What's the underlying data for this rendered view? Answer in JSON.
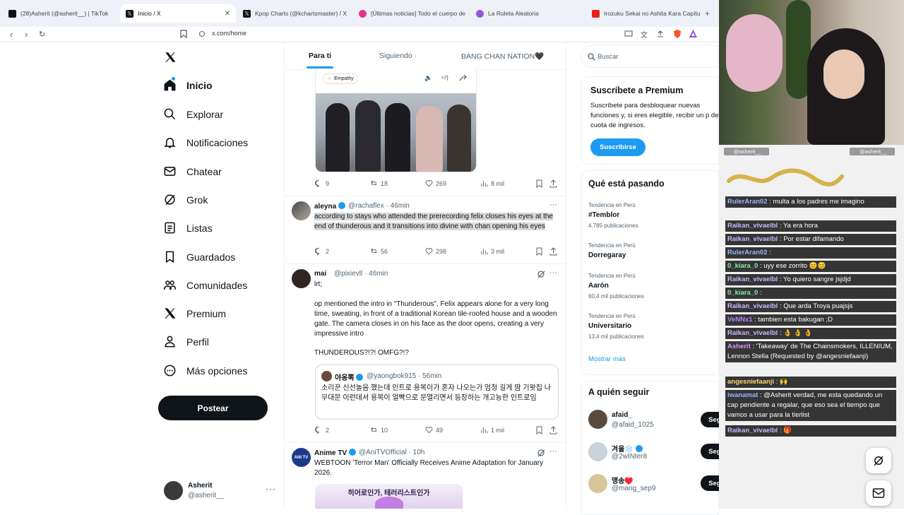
{
  "browser": {
    "tabs": [
      {
        "label": "(28)Asherit (@asherit__) | TikTok",
        "icon": "tiktok-icon",
        "color": "#111"
      },
      {
        "label": "Inicio / X",
        "icon": "x-logo-icon",
        "color": "#111",
        "active": true
      },
      {
        "label": "Kpop Charts (@kchartsmaster) / X",
        "icon": "x-logo-icon",
        "color": "#111"
      },
      {
        "label": "[Últimas noticias] Todo el cuerpo de",
        "icon": "news-icon",
        "color": "#e0348c"
      },
      {
        "label": "La Ruleta Aleatoria",
        "icon": "roulette-icon",
        "color": "#8e5cd6"
      },
      {
        "label": "Irozuku Sekai no Ashita Kara Capítulo",
        "icon": "youtube-icon",
        "color": "#e62117"
      }
    ],
    "url": "x.com/home"
  },
  "sidebar": {
    "items": [
      {
        "label": "Inicio",
        "icon": "home-icon",
        "active": true
      },
      {
        "label": "Explorar",
        "icon": "search-icon"
      },
      {
        "label": "Notificaciones",
        "icon": "bell-icon"
      },
      {
        "label": "Chatear",
        "icon": "mail-icon"
      },
      {
        "label": "Grok",
        "icon": "grok-icon"
      },
      {
        "label": "Listas",
        "icon": "list-icon"
      },
      {
        "label": "Guardados",
        "icon": "bookmark-icon"
      },
      {
        "label": "Comunidades",
        "icon": "people-icon"
      },
      {
        "label": "Premium",
        "icon": "x-logo-icon"
      },
      {
        "label": "Perfil",
        "icon": "person-icon"
      },
      {
        "label": "Más opciones",
        "icon": "more-circle-icon"
      }
    ],
    "post_label": "Postear",
    "account": {
      "name": "Asherit",
      "handle": "@asherit__"
    }
  },
  "timeline": {
    "tabs": [
      "Para ti",
      "Siguiendo",
      "BANG CHAN NATION🖤"
    ],
    "media_bar": {
      "badge": "Empathy",
      "lang": "가"
    },
    "tweets": [
      {
        "actions": {
          "replies": "9",
          "retweets": "18",
          "likes": "269",
          "views": "8 mil"
        }
      },
      {
        "name": "aleyna",
        "handle": "@rachaflex · 46min",
        "text": "according to stays who attended the prerecording felix closes his eyes at the end of thunderous and it transitions into divine with chan opening his eyes",
        "actions": {
          "replies": "2",
          "retweets": "56",
          "likes": "298",
          "views": "3 mil"
        }
      },
      {
        "name": "mai",
        "handle": "@pixievll · 46min",
        "line1": "lrt;",
        "text": "op mentioned the intro in “Thunderous”, Felix appears alone for a very long time, sweating, in front of a traditional Korean tile-roofed house and a wooden gate. The camera closes in on his face as the door opens, creating a very impressive intro",
        "line3": "THUNDEROUS?!?! OMFG?!?",
        "quote": {
          "name": "야옹뽁",
          "handle": "@yaongbok915 · 56min",
          "text": "소리꾼 신선놀음 했는데 인트로 용복이가 혼자 나오는가 엄청 길게 땀 기왓집 나무대문 이런데서 용복이 얼빡으로 문열리면서 등장하는 개고능한 인트로임"
        },
        "actions": {
          "replies": "2",
          "retweets": "10",
          "likes": "49",
          "views": "1 mil"
        }
      },
      {
        "name": "Anime TV",
        "handle": "@AniTVOfficial · 10h",
        "text": "WEBTOON 'Terror Man' Officially Receives Anime Adaptation for January 2026.",
        "image_text": "히어로인가, 테러리스트인가"
      }
    ]
  },
  "right": {
    "search_placeholder": "Buscar",
    "premium": {
      "title": "Suscríbete a Premium",
      "body": "Suscríbete para desbloquear nuevas funciones y, si eres elegible, recibir un p de cuota de ingresos.",
      "button": "Suscribirse"
    },
    "trending": {
      "title": "Qué está pasando",
      "items": [
        {
          "context": "Tendencia en Perú",
          "topic": "#Temblor",
          "count": "4.785 publicaciones"
        },
        {
          "context": "Tendencia en Perú",
          "topic": "Dorregaray",
          "count": ""
        },
        {
          "context": "Tendencia en Perú",
          "topic": "Aarón",
          "count": "60,4 mil publicaciones"
        },
        {
          "context": "Tendencia en Perú",
          "topic": "Universitario",
          "count": "13,4 mil publicaciones"
        }
      ],
      "more": "Mostrar más"
    },
    "who_to_follow": {
      "title": "A quién seguir",
      "users": [
        {
          "name": "afaid_",
          "handle": "@afaid_1025",
          "button": "Seguir"
        },
        {
          "name": "겨울❄️",
          "handle": "@2wINter8",
          "button": "Seguir"
        },
        {
          "name": "맹송♥️",
          "handle": "@mang_sep9",
          "button": "Seguir"
        }
      ]
    }
  },
  "stream": {
    "labels": [
      "@asherit__",
      "@asherit__"
    ],
    "chat": [
      {
        "user": "RulerAran02",
        "msg": ": multa a los padres me imagino"
      },
      {
        "user": "Raikan_vivaelbl",
        "msg": ": Ya era hora"
      },
      {
        "user": "Raikan_vivaelbl",
        "msg": ": Por estar difamando"
      },
      {
        "user": "RulerAran02",
        "msg": ":"
      },
      {
        "user": "0_kiara_0",
        "msg": ": uyy ese zorrito 😊😊"
      },
      {
        "user": "Raikan_vivaelbl",
        "msg": ": Yo quiero sangre jsjdjd"
      },
      {
        "user": "0_kiara_0",
        "msg": ":"
      },
      {
        "user": "Raikan_vivaelbl",
        "msg": ": Que arda Troya puajsjs"
      },
      {
        "user": "VeNNx1",
        "msg": ": tambien esta bakugan ;D"
      },
      {
        "user": "Raikan_vivaelbl",
        "msg": ": 👌 👌 👌"
      },
      {
        "user": "Asherit",
        "msg": ": 'Takeaway' de The Chainsmokers, ILLENIUM, Lennon Stella (Requested by @angesniefaanji)"
      },
      {
        "user": "angesniefaanji",
        "msg": ": 🙌"
      },
      {
        "user": "iwanamat",
        "msg": ": @Asherit verdad, me esta quedando un cap pendiente a regalar, que eso sea el tiempo que vamos a usar para la tierlist"
      },
      {
        "user": "Raikan_vivaelbl",
        "msg": ": 🎁"
      }
    ]
  },
  "colors": {
    "accent": "#1d9bf0",
    "text": "#0f1419",
    "muted": "#536471",
    "chat_user": "#c9b6ff"
  }
}
